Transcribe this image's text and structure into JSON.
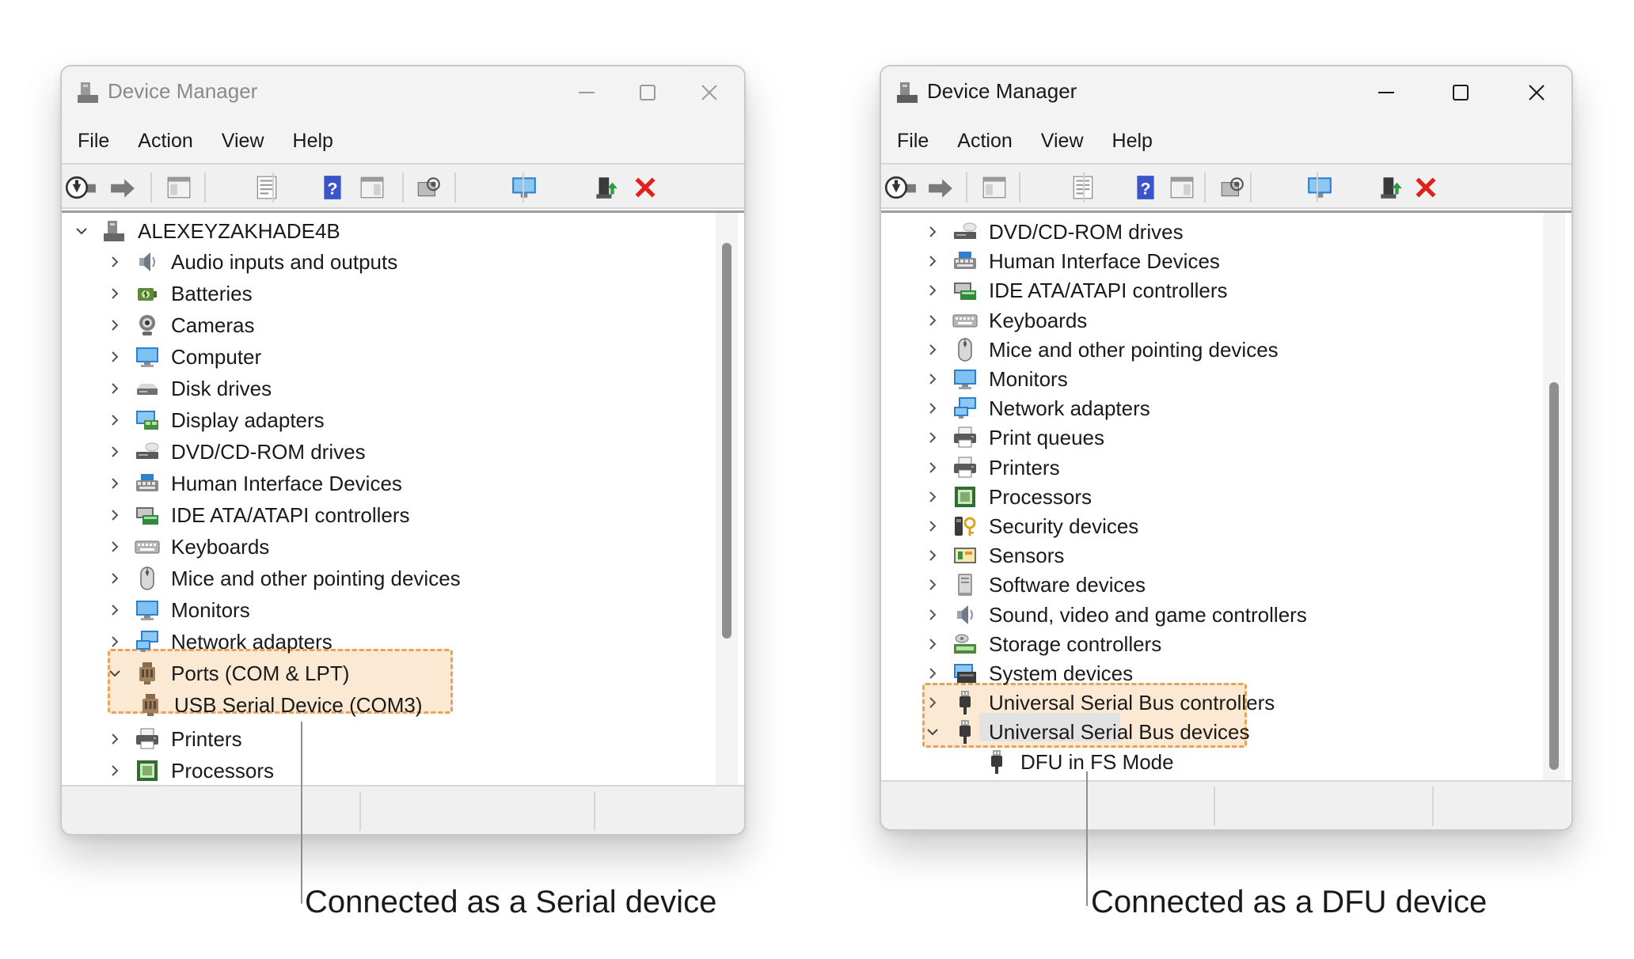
{
  "left_window": {
    "title": "Device Manager",
    "menu": [
      "File",
      "Action",
      "View",
      "Help"
    ],
    "root": "ALEXEYZAKHADE4B",
    "items": [
      {
        "label": "Audio inputs and outputs",
        "icon": "speaker-icon"
      },
      {
        "label": "Batteries",
        "icon": "battery-icon"
      },
      {
        "label": "Cameras",
        "icon": "camera-icon"
      },
      {
        "label": "Computer",
        "icon": "monitor-icon"
      },
      {
        "label": "Disk drives",
        "icon": "disk-drive-icon"
      },
      {
        "label": "Display adapters",
        "icon": "display-adapter-icon"
      },
      {
        "label": "DVD/CD-ROM drives",
        "icon": "dvd-drive-icon"
      },
      {
        "label": "Human Interface Devices",
        "icon": "hid-icon"
      },
      {
        "label": "IDE ATA/ATAPI controllers",
        "icon": "ide-controller-icon"
      },
      {
        "label": "Keyboards",
        "icon": "keyboard-icon"
      },
      {
        "label": "Mice and other pointing devices",
        "icon": "mouse-icon"
      },
      {
        "label": "Monitors",
        "icon": "monitor-icon"
      },
      {
        "label": "Network adapters",
        "icon": "network-adapter-icon"
      },
      {
        "label": "Ports (COM & LPT)",
        "icon": "port-icon",
        "expanded": true
      },
      {
        "label": "USB Serial Device (COM3)",
        "icon": "port-icon",
        "child": true
      },
      {
        "label": "Printers",
        "icon": "printer-icon"
      },
      {
        "label": "Processors",
        "icon": "processor-icon"
      }
    ]
  },
  "right_window": {
    "title": "Device Manager",
    "menu": [
      "File",
      "Action",
      "View",
      "Help"
    ],
    "items": [
      {
        "label": "DVD/CD-ROM drives",
        "icon": "dvd-drive-icon"
      },
      {
        "label": "Human Interface Devices",
        "icon": "hid-icon"
      },
      {
        "label": "IDE ATA/ATAPI controllers",
        "icon": "ide-controller-icon"
      },
      {
        "label": "Keyboards",
        "icon": "keyboard-icon"
      },
      {
        "label": "Mice and other pointing devices",
        "icon": "mouse-icon"
      },
      {
        "label": "Monitors",
        "icon": "monitor-icon"
      },
      {
        "label": "Network adapters",
        "icon": "network-adapter-icon"
      },
      {
        "label": "Print queues",
        "icon": "printer-icon"
      },
      {
        "label": "Printers",
        "icon": "printer-icon"
      },
      {
        "label": "Processors",
        "icon": "processor-icon"
      },
      {
        "label": "Security devices",
        "icon": "security-device-icon"
      },
      {
        "label": "Sensors",
        "icon": "sensor-icon"
      },
      {
        "label": "Software devices",
        "icon": "software-device-icon"
      },
      {
        "label": "Sound, video and game controllers",
        "icon": "speaker-icon"
      },
      {
        "label": "Storage controllers",
        "icon": "storage-controller-icon"
      },
      {
        "label": "System devices",
        "icon": "system-device-icon"
      },
      {
        "label": "Universal Serial Bus controllers",
        "icon": "usb-icon"
      },
      {
        "label": "Universal Serial Bus devices",
        "icon": "usb-icon",
        "expanded": true
      },
      {
        "label": "DFU in FS Mode",
        "icon": "usb-icon",
        "child": true,
        "selected": true
      }
    ]
  },
  "captions": {
    "left": "Connected as a Serial device",
    "right": "Connected as a DFU device"
  },
  "colors": {
    "highlight_fill": "#f7cea0",
    "highlight_border": "#e8a35a",
    "delete_red": "#e0201b",
    "help_blue": "#3a55c9"
  }
}
